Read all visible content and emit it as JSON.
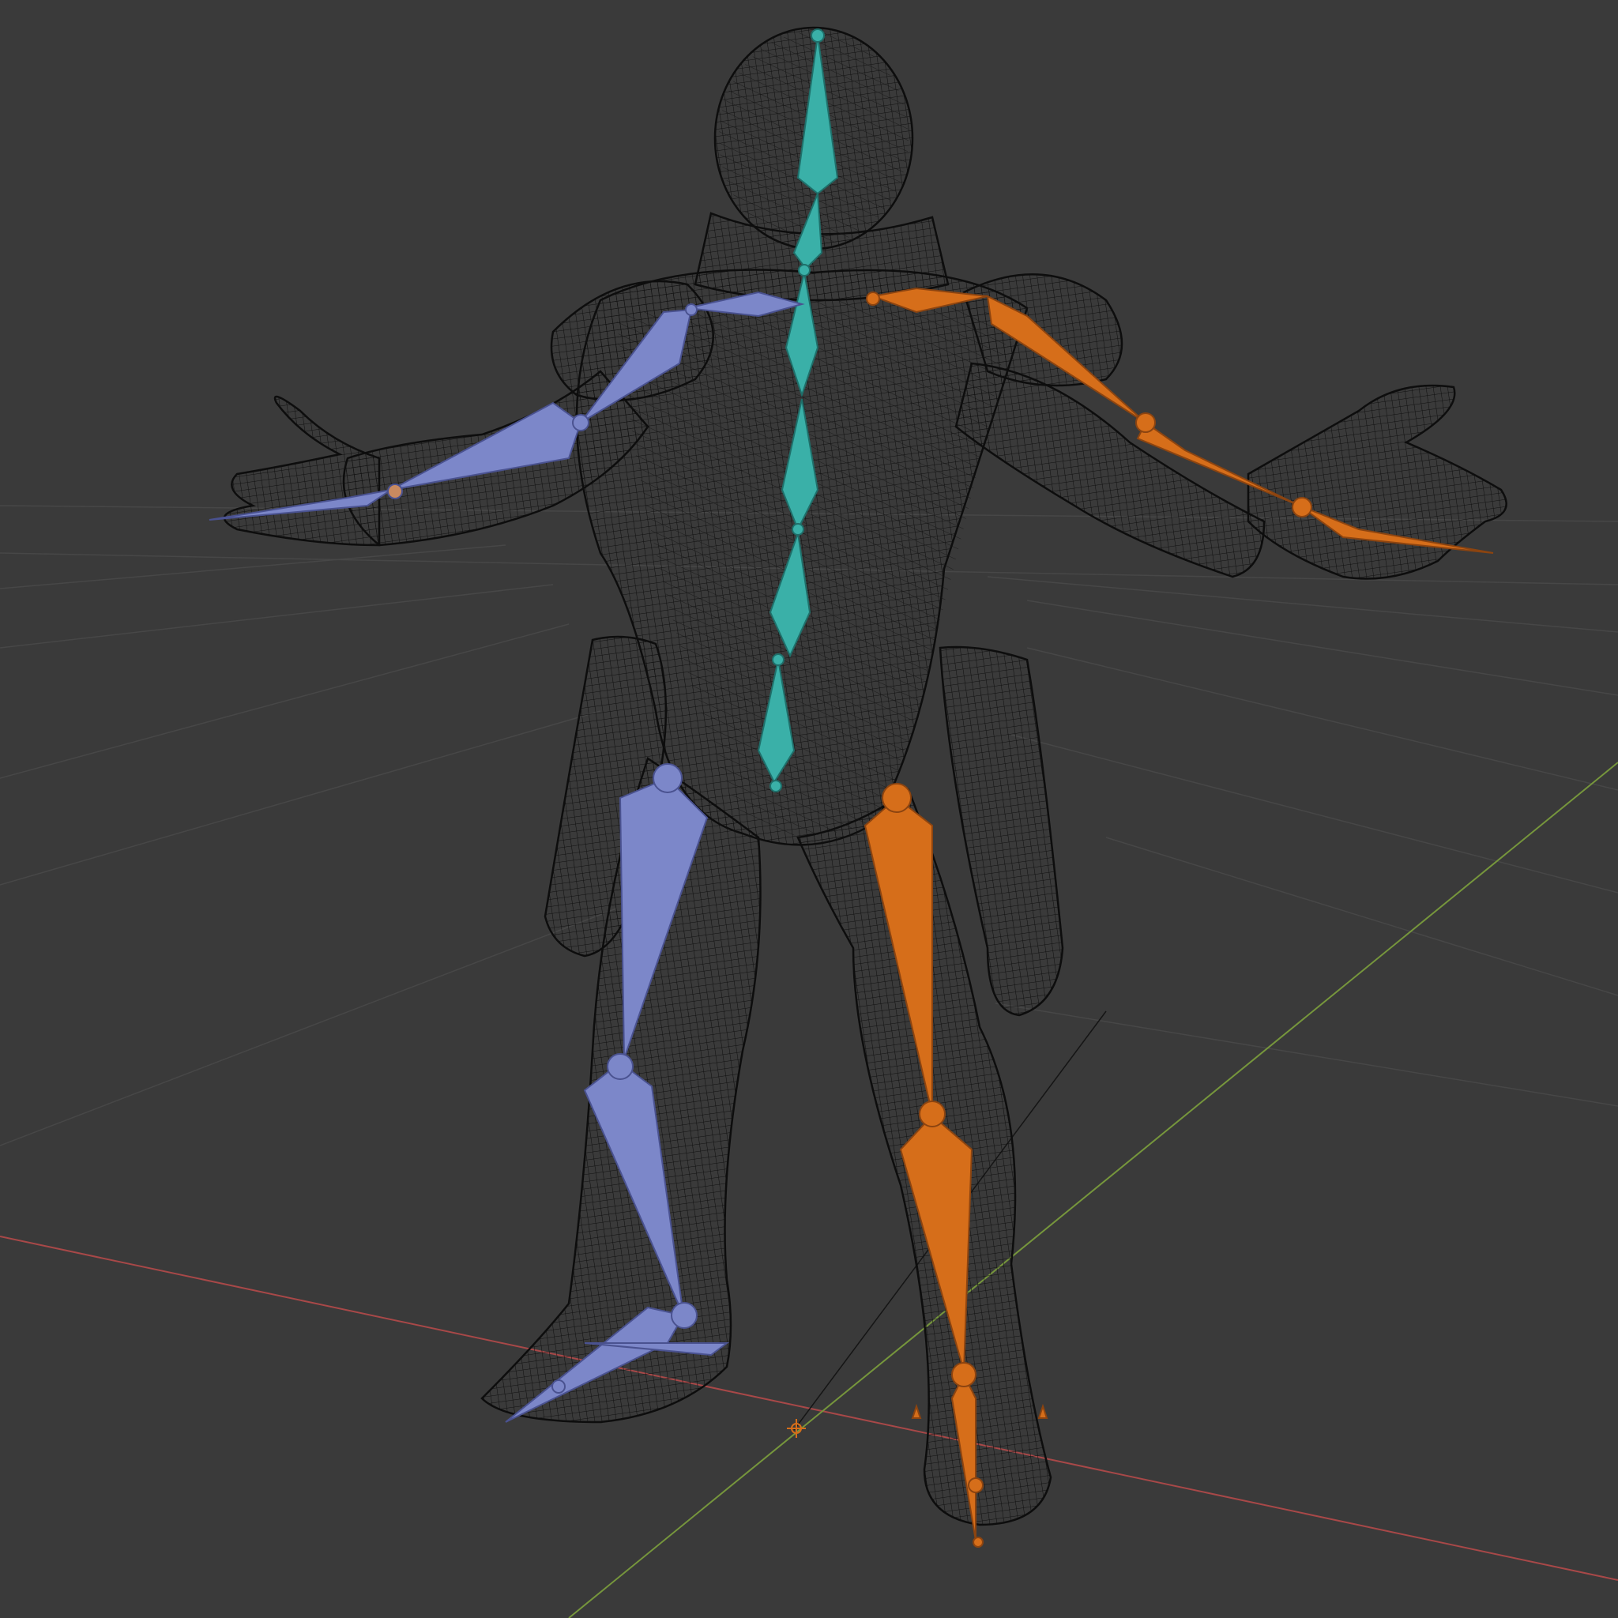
{
  "viewport": {
    "background_color": "#3a3a3a",
    "view_mode": "wireframe",
    "x_axis_color": "#b34a4a",
    "y_axis_color": "#7ea041",
    "grid_color": "#4a4a4a",
    "mesh_color": "#111111"
  },
  "armature": {
    "spine_color": "#3ab0a8",
    "left_side_color": "#7c87c9",
    "right_side_color": "#d66e1a",
    "icons": [
      "bone-icon",
      "joint-icon",
      "origin-icon"
    ]
  }
}
